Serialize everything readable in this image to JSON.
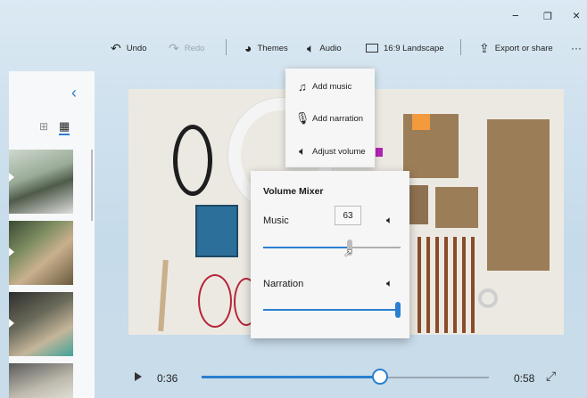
{
  "window": {
    "controls": [
      "−",
      "❐",
      "×"
    ]
  },
  "toolbar": {
    "undo_label": "Undo",
    "redo_label": "Redo",
    "themes_label": "Themes",
    "audio_label": "Audio",
    "aspect_label": "16:9 Landscape",
    "export_label": "Export or share",
    "more_label": "···"
  },
  "audio_menu": {
    "items": [
      {
        "label": "Add music",
        "icon": "music-note-icon"
      },
      {
        "label": "Add narration",
        "icon": "microphone-icon"
      },
      {
        "label": "Adjust volume",
        "icon": "speaker-icon"
      }
    ]
  },
  "volume_mixer": {
    "title": "Volume Mixer",
    "music_label": "Music",
    "music_value": 63,
    "music_value_text": "63",
    "narration_label": "Narration",
    "narration_value": 100
  },
  "playback": {
    "current_time": "0:36",
    "total_time": "0:58",
    "progress": 0.62
  },
  "colors": {
    "accent": "#2a7fd0",
    "orange_square": "#f39a3c",
    "magenta_marker": "#b224b6"
  }
}
